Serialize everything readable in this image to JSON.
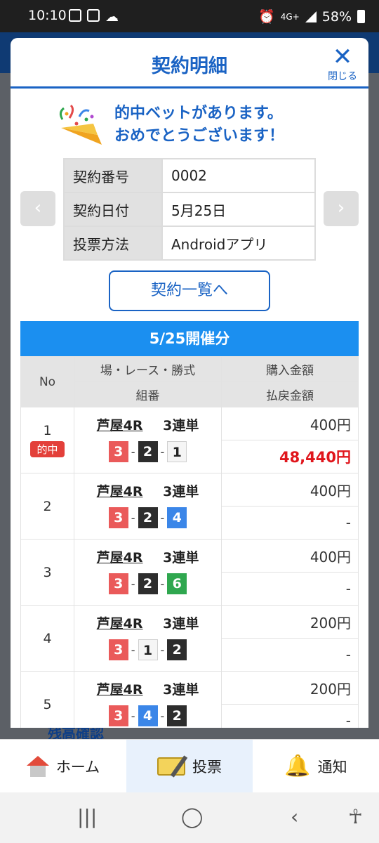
{
  "status": {
    "time": "10:10",
    "battery": "58%",
    "network": "4G+"
  },
  "modal": {
    "title": "契約明細",
    "close_label": "閉じる"
  },
  "congrats": {
    "line1": "的中ベットがあります。",
    "line2": "おめでとうございます！"
  },
  "contract": {
    "rows": [
      {
        "label": "契約番号",
        "value": "0002"
      },
      {
        "label": "契約日付",
        "value": "5月25日"
      },
      {
        "label": "投票方法",
        "value": "Androidアプリ"
      }
    ]
  },
  "list_button": "契約一覧へ",
  "event_header": "5/25開催分",
  "table_headers": {
    "no": "No",
    "race": "場・レース・勝式",
    "purchase": "購入金額",
    "combo": "組番",
    "payout": "払戻金額"
  },
  "bets": [
    {
      "no": "1",
      "hit": "的中",
      "race": "芦屋4R",
      "type": "3連単",
      "combo": [
        "3",
        "2",
        "1"
      ],
      "purchase": "400円",
      "payout": "48,440円"
    },
    {
      "no": "2",
      "race": "芦屋4R",
      "type": "3連単",
      "combo": [
        "3",
        "2",
        "4"
      ],
      "purchase": "400円",
      "payout": "-"
    },
    {
      "no": "3",
      "race": "芦屋4R",
      "type": "3連単",
      "combo": [
        "3",
        "2",
        "6"
      ],
      "purchase": "400円",
      "payout": "-"
    },
    {
      "no": "4",
      "race": "芦屋4R",
      "type": "3連単",
      "combo": [
        "3",
        "1",
        "2"
      ],
      "purchase": "200円",
      "payout": "-"
    },
    {
      "no": "5",
      "race": "芦屋4R",
      "type": "3連単",
      "combo": [
        "3",
        "4",
        "2"
      ],
      "purchase": "200円",
      "payout": "-"
    }
  ],
  "background": {
    "partial_text": "残高確認"
  },
  "bottom_nav": {
    "home": "ホーム",
    "vote": "投票",
    "notify": "通知"
  },
  "colors": {
    "accent": "#1a63c4",
    "event_bar": "#1b8ff0",
    "hit": "#e0161c"
  },
  "icons": {
    "home": "house-icon",
    "vote": "ticket-pen-icon",
    "notify": "bell-icon",
    "close": "close-icon"
  }
}
